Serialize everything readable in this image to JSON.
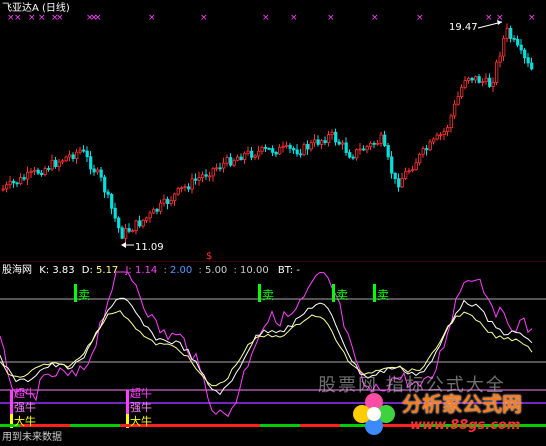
{
  "header": {
    "stock_name": "飞亚达A",
    "period": "(日线)"
  },
  "price_chart": {
    "high_label": "19.47",
    "low_label": "11.09",
    "dollar_marker": "$"
  },
  "indicator": {
    "name": "股海网",
    "k_label": "K:",
    "k_value": "3.83",
    "d_label": "D:",
    "d_value": "5.17",
    "j_label": "J:",
    "j_value": "1.14",
    "v1": "2.00",
    "v2": "5.00",
    "v3": "10.00",
    "bt_label": "BT:",
    "bt_value": "-",
    "sep": ":",
    "sell_label": "卖",
    "super_bull_label": "超牛",
    "strong_bull_label": "强牛",
    "big_bull_label": "大牛",
    "future_data_text": "用到未来数据"
  },
  "watermark": {
    "site_text": "股票网 指标公式大全",
    "brand": "分析家公式网",
    "url": "www.88gs.com"
  },
  "colors": {
    "background": "#000000",
    "up_candle": "#ff3030",
    "down_candle": "#00e0e0",
    "magenta": "#ff40ff",
    "white": "#ffffff",
    "green": "#00ff00",
    "yellow": "#ffff00",
    "purple_line": "#9933ff",
    "j_color": "#ff40ff",
    "blue_value": "#5599ff"
  }
}
